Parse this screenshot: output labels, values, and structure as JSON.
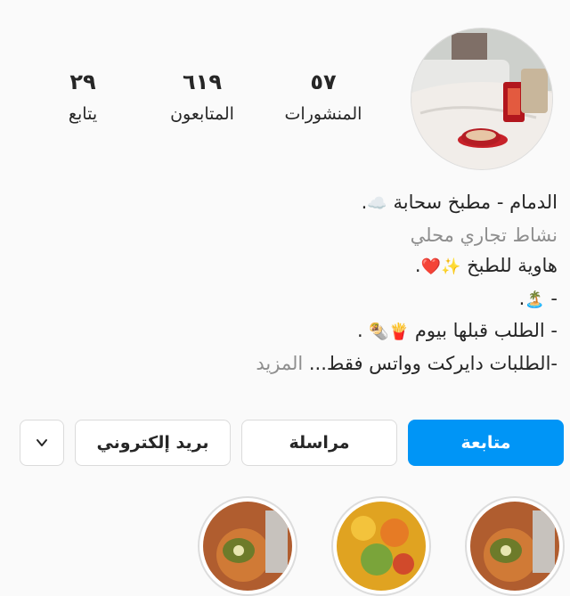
{
  "profile": {
    "stats": [
      {
        "num": "٥٧",
        "label": "المنشورات"
      },
      {
        "num": "٦١٩",
        "label": "المتابعون"
      },
      {
        "num": "٢٩",
        "label": "يتابع"
      }
    ],
    "bio": {
      "name_line": "الدمام - مطبخ سحابة",
      "name_emoji": "☁️",
      "category": "نشاط تجاري محلي",
      "line1": "هاوية للطبخ",
      "line1_emoji": "✨❤️",
      "line2_prefix": "-",
      "line2_emoji": "🏝️",
      "line3": "- الطلب قبلها بيوم",
      "line3_emoji": "🍟🌯",
      "line4": "-الطلبات دايركت وواتس فقط...",
      "more": "المزيد"
    }
  },
  "actions": {
    "follow": "متابعة",
    "message": "مراسلة",
    "email": "بريد إلكتروني",
    "more_icon": "chevron-down-icon"
  },
  "highlights": {
    "count": 3
  },
  "colors": {
    "accent": "#0095f6"
  }
}
